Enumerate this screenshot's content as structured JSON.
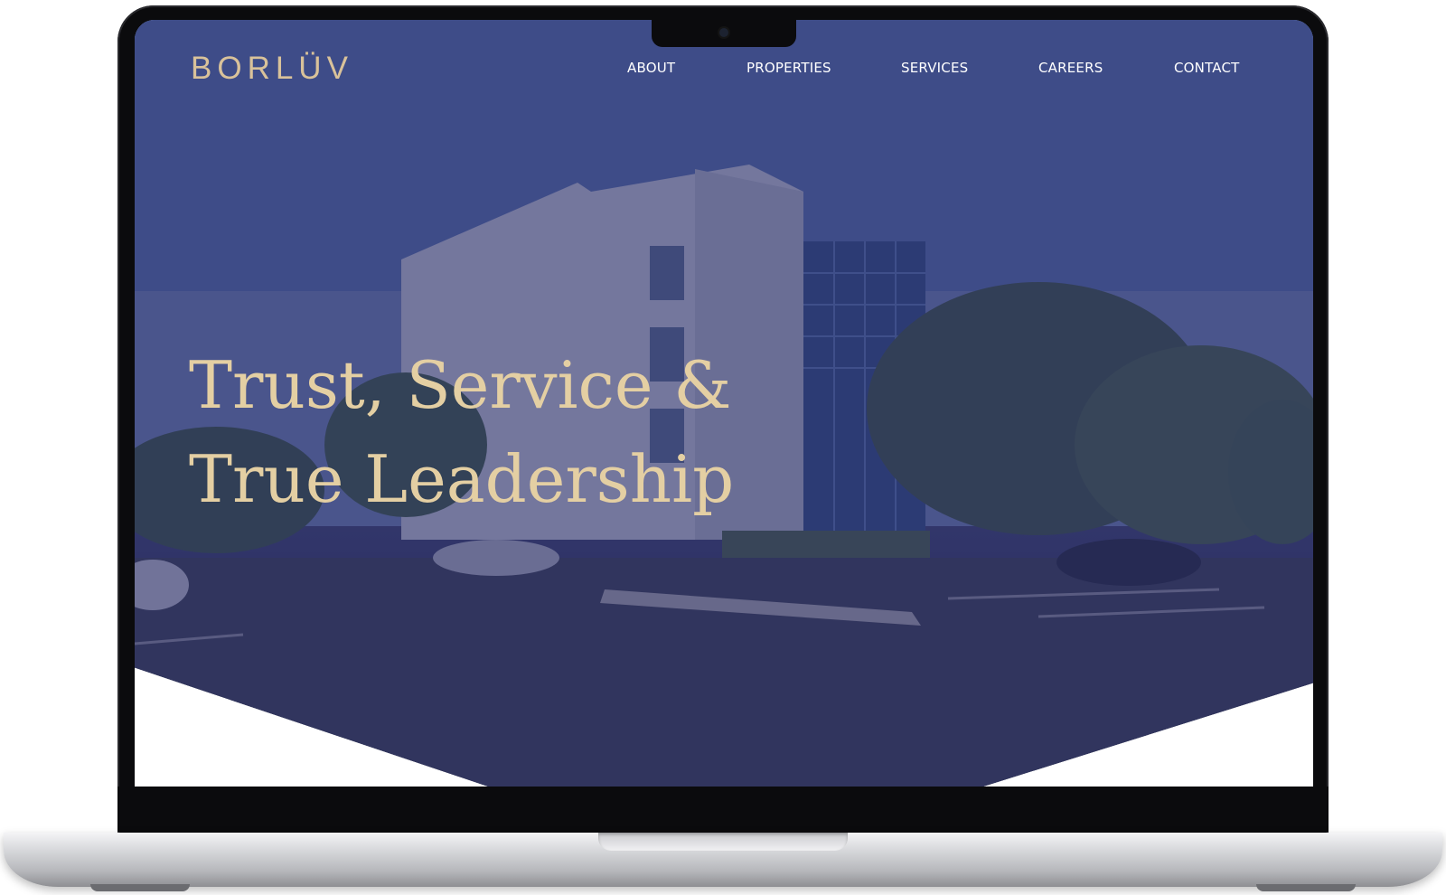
{
  "site": {
    "brand": "BORLÜV",
    "nav": {
      "about": "ABOUT",
      "properties": "PROPERTIES",
      "services": "SERVICES",
      "careers": "CAREERS",
      "contact": "CONTACT"
    },
    "hero": {
      "headline_line1": "Trust, Service &",
      "headline_line2": "True Leadership"
    }
  },
  "colors": {
    "brand_gold": "#d9c29a",
    "headline_gold": "#e4cfa3",
    "overlay_navy": "#2c2e69",
    "nav_text": "#ffffff"
  }
}
